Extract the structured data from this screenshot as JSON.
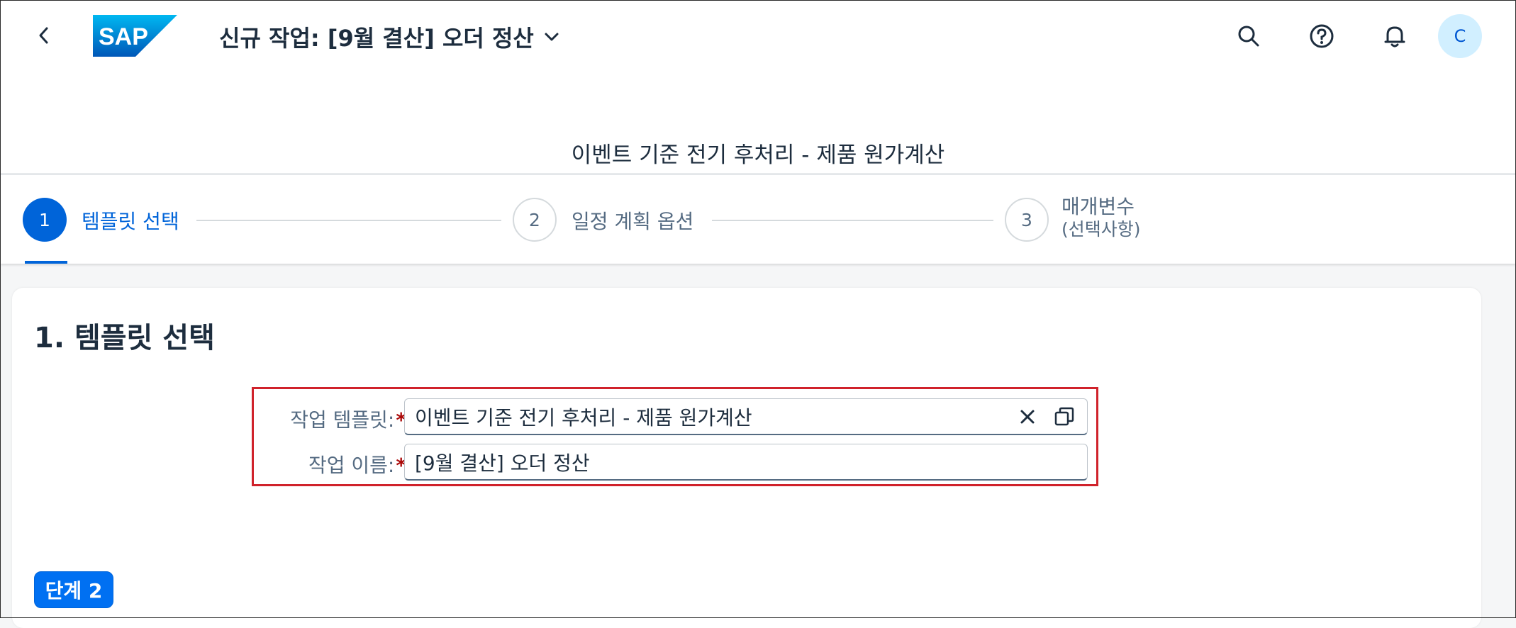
{
  "header": {
    "brand": "SAP",
    "title": "신규 작업: [9월 결산] 오더 정산",
    "avatar_initial": "C",
    "icons": [
      "back-icon",
      "search-icon",
      "help-icon",
      "notification-bell-icon",
      "chevron-down-icon"
    ]
  },
  "wizard": {
    "title": "이벤트 기준 전기 후처리 - 제품 원가계산",
    "steps": [
      {
        "number": "1",
        "label": "템플릿 선택",
        "active": true
      },
      {
        "number": "2",
        "label": "일정 계획 옵션",
        "active": false
      },
      {
        "number": "3",
        "label_line1": "매개변수",
        "label_line2": "(선택사항)",
        "active": false
      }
    ]
  },
  "section": {
    "title": "1. 템플릿 선택",
    "fields": {
      "template": {
        "label": "작업 템플릿:",
        "required": "*",
        "value": "이벤트 기준 전기 후처리 - 제품 원가계산"
      },
      "name": {
        "label": "작업 이름:",
        "required": "*",
        "value": "[9월 결산] 오더 정산"
      }
    },
    "next_button": "단계 2"
  },
  "colors": {
    "accent": "#0064d9",
    "button": "#0070f2",
    "highlight_border": "#d0222b",
    "required": "#aa0808",
    "avatar_bg": "#d1efff"
  }
}
